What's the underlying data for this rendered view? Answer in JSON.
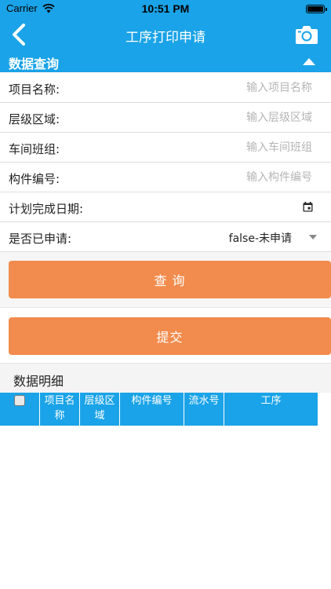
{
  "status_bar": {
    "carrier": "Carrier",
    "time": "10:51 PM"
  },
  "nav": {
    "title": "工序打印申请",
    "back_icon": "chevron-left-icon",
    "camera_icon": "camera-icon"
  },
  "query_section": {
    "title": "数据查询",
    "toggle_icon": "triangle-up-icon",
    "fields": {
      "project_name": {
        "label": "项目名称:",
        "placeholder": "输入项目名称"
      },
      "level_area": {
        "label": "层级区域:",
        "placeholder": "输入层级区域"
      },
      "workshop_team": {
        "label": "车间班组:",
        "placeholder": "输入车间班组"
      },
      "component_no": {
        "label": "构件编号:",
        "placeholder": "输入构件编号"
      },
      "plan_date": {
        "label": "计划完成日期:",
        "icon": "calendar-icon"
      },
      "applied": {
        "label": "是否已申请:",
        "value": "false-未申请",
        "icon": "dropdown-caret-icon"
      }
    }
  },
  "buttons": {
    "query": "查 询",
    "submit": "提交",
    "color": "#f28c4e"
  },
  "detail_section": {
    "title": "数据明细"
  },
  "table": {
    "columns": [
      "",
      "项目名称",
      "层级区域",
      "构件编号",
      "流水号",
      "工序"
    ]
  },
  "colors": {
    "primary": "#1aa3e8",
    "accent": "#f28c4e"
  }
}
